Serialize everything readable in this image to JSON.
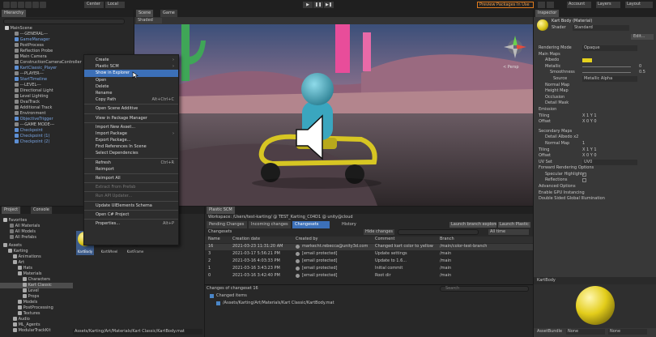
{
  "toolbar": {
    "center_label": "Center",
    "local_label": "Local",
    "preview_packages": "Preview Packages In Use",
    "account_label": "Account",
    "layers_label": "Layers",
    "layout_label": "Layout"
  },
  "hierarchy": {
    "tab": "Hierarchy",
    "items": [
      "MainScene",
      "---GENERAL---",
      "GameManager",
      "PostProcess",
      "Reflection Probe",
      "Main Camera",
      "ConstructionCameraController",
      "KartClassic_Player",
      "---PLAYER---",
      "StartTimeline",
      "---LEVEL---",
      "Directional Light",
      "Level Lighting",
      "OvalTrack",
      "Additional Track",
      "Environment",
      "ObjectiveTrigger",
      "---GAME MODE---",
      "Checkpoint",
      "Checkpoint (1)",
      "Checkpoint (2)"
    ]
  },
  "context_menu": {
    "items": [
      {
        "label": "Create",
        "shortcut": ""
      },
      {
        "label": "Plastic SCM",
        "shortcut": ""
      },
      {
        "label": "Show in Explorer",
        "shortcut": ""
      },
      {
        "label": "Open",
        "shortcut": ""
      },
      {
        "label": "Delete",
        "shortcut": ""
      },
      {
        "label": "Rename",
        "shortcut": ""
      },
      {
        "label": "Copy Path",
        "shortcut": "Alt+Ctrl+C"
      },
      {
        "label": "Open Scene Additive",
        "shortcut": ""
      },
      {
        "label": "View in Package Manager",
        "shortcut": ""
      },
      {
        "label": "Import New Asset...",
        "shortcut": ""
      },
      {
        "label": "Import Package",
        "shortcut": ""
      },
      {
        "label": "Export Package...",
        "shortcut": ""
      },
      {
        "label": "Find References In Scene",
        "shortcut": ""
      },
      {
        "label": "Select Dependencies",
        "shortcut": ""
      },
      {
        "label": "Refresh",
        "shortcut": "Ctrl+R"
      },
      {
        "label": "Reimport",
        "shortcut": ""
      },
      {
        "label": "Reimport All",
        "shortcut": ""
      },
      {
        "label": "Extract From Prefab",
        "shortcut": ""
      },
      {
        "label": "Run API Updater...",
        "shortcut": ""
      },
      {
        "label": "Update UIElements Schema",
        "shortcut": ""
      },
      {
        "label": "Open C# Project",
        "shortcut": ""
      },
      {
        "label": "Properties...",
        "shortcut": "Alt+P"
      }
    ]
  },
  "scene": {
    "scene_tab": "Scene",
    "game_tab": "Game",
    "shaded_label": "Shaded",
    "persp_label": "< Persp"
  },
  "project": {
    "project_tab": "Project",
    "console_tab": "Console",
    "tree": [
      "Favorites",
      "All Materials",
      "All Models",
      "All Prefabs",
      "Assets",
      "Karting",
      "Animations",
      "Art",
      "Hats",
      "Materials",
      "Characters",
      "Kart Classic",
      "Level",
      "Props",
      "Models",
      "PostProcessing",
      "Textures",
      "Audio",
      "ML_Agents",
      "ModularTrackKit"
    ],
    "assets": [
      "KartBody",
      "KartWheel",
      "KartFrame"
    ],
    "path": "Assets/Karting/Art/Materials/Kart Classic/KartBody.mat"
  },
  "plastic": {
    "tab": "Plastic SCM",
    "workspace": "Workspace: /Users/test-karting/ @ TEST_Karting_C04D1 @ unity@cloud",
    "tabs": [
      "Pending Changes",
      "Incoming changes",
      "Changesets"
    ],
    "history_btn": "History",
    "launch_branch_explorer": "Launch branch explorer",
    "launch_plastic": "Launch Plastic",
    "changesets_label": "Changesets",
    "hide_changes": "Hide changes",
    "filter_all": "All time",
    "columns": [
      "Name",
      "Creation date",
      "Created by",
      "Comment",
      "Branch"
    ],
    "rows": [
      [
        "16",
        "2021-03-23 11:31:20 AM",
        "markecht.rebecca@unity3d.com",
        "Changed kart color to yellow",
        "/main/color-test-branch"
      ],
      [
        "3",
        "2021-03-17 5:56:21 PM",
        "[email protected]",
        "Update settings",
        "/main"
      ],
      [
        "2",
        "2021-03-16 4:03:33 PM",
        "[email protected]",
        "Update to 1.6...",
        "/main"
      ],
      [
        "1",
        "2021-03-16 3:43:23 PM",
        "[email protected]",
        "Initial commit",
        "/main"
      ],
      [
        "0",
        "2021-03-16 3:42:40 PM",
        "[email protected]",
        "Root dir",
        "/main"
      ]
    ],
    "changes_header": "Changes of changeset 16",
    "changed_items": "Changed items",
    "changed_file": "/Assets/Karting/Art/Materials/Kart Classic/KartBody.mat",
    "search_placeholder": "Search"
  },
  "inspector": {
    "tab": "Inspector",
    "material_name": "Kart Body (Material)",
    "shader_label": "Shader",
    "shader_value": "Standard",
    "edit_btn": "Edit...",
    "props": [
      [
        "Rendering Mode",
        "Opaque"
      ],
      [
        "Main Maps",
        ""
      ],
      [
        "Albedo",
        ""
      ],
      [
        "Metallic",
        "0"
      ],
      [
        "Smoothness",
        "0.5"
      ],
      [
        "Source",
        "Metallic Alpha"
      ],
      [
        "Normal Map",
        ""
      ],
      [
        "Height Map",
        ""
      ],
      [
        "Occlusion",
        ""
      ],
      [
        "Detail Mask",
        ""
      ],
      [
        "Emission",
        ""
      ],
      [
        "Tiling",
        "X 1   Y 1"
      ],
      [
        "Offset",
        "X 0   Y 0"
      ],
      [
        "Secondary Maps",
        ""
      ],
      [
        "Detail Albedo x2",
        ""
      ],
      [
        "Normal Map",
        "1"
      ],
      [
        "Tiling",
        "X 1   Y 1"
      ],
      [
        "Offset",
        "X 0   Y 0"
      ],
      [
        "UV Set",
        "UV0"
      ],
      [
        "Forward Rendering Options",
        ""
      ],
      [
        "Specular Highlights",
        ""
      ],
      [
        "Reflections",
        ""
      ],
      [
        "Advanced Options",
        ""
      ],
      [
        "Enable GPU Instancing",
        ""
      ],
      [
        "Double Sided Global Illumination",
        ""
      ]
    ],
    "preview_name": "KartBody",
    "assetbundle_label": "AssetBundle",
    "assetbundle_value": "None",
    "assetbundle_variant": "None"
  },
  "colors": {
    "albedo": "#e6d21e",
    "accent": "#3c70b8"
  }
}
